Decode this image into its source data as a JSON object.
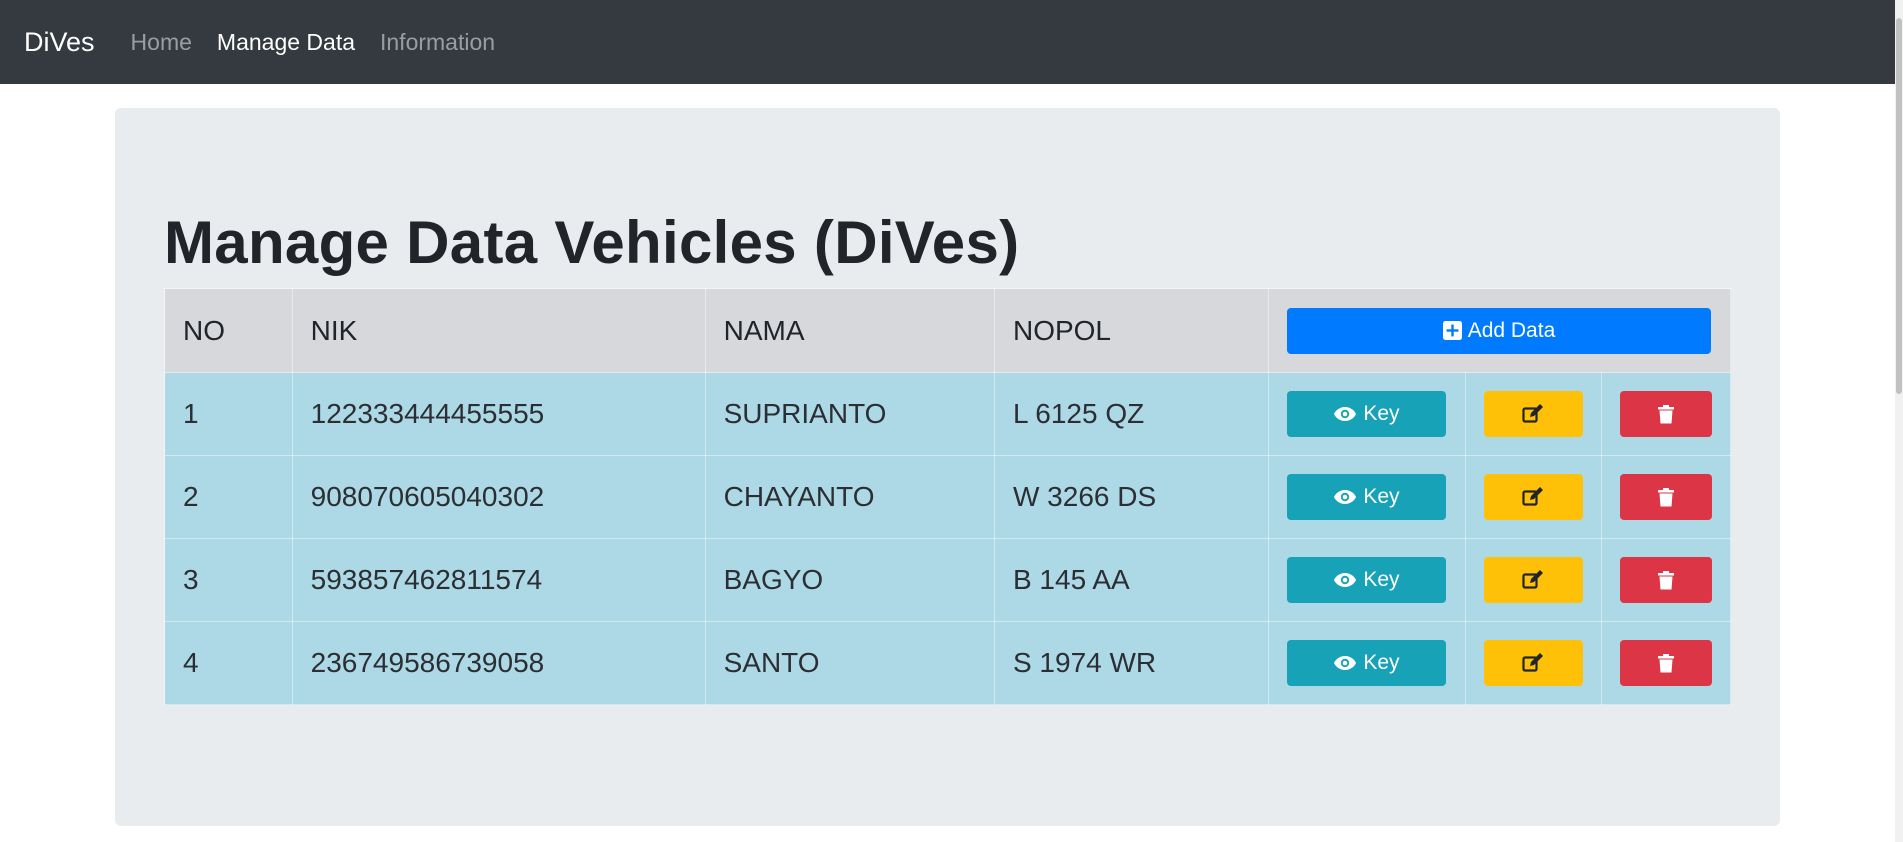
{
  "navbar": {
    "brand": "DiVes",
    "links": [
      {
        "label": "Home",
        "active": false
      },
      {
        "label": "Manage Data",
        "active": true
      },
      {
        "label": "Information",
        "active": false
      }
    ]
  },
  "page": {
    "title": "Manage Data Vehicles (DiVes)"
  },
  "table": {
    "headers": {
      "no": "NO",
      "nik": "NIK",
      "nama": "NAMA",
      "nopol": "NOPOL"
    },
    "add_button_label": "Add Data",
    "key_button_label": "Key",
    "rows": [
      {
        "no": "1",
        "nik": "122333444455555",
        "nama": "SUPRIANTO",
        "nopol": "L 6125 QZ"
      },
      {
        "no": "2",
        "nik": "908070605040302",
        "nama": "CHAYANTO",
        "nopol": "W 3266 DS"
      },
      {
        "no": "3",
        "nik": "593857462811574",
        "nama": "BAGYO",
        "nopol": "B 145 AA"
      },
      {
        "no": "4",
        "nik": "236749586739058",
        "nama": "SANTO",
        "nopol": "S 1974 WR"
      }
    ]
  },
  "colors": {
    "navbar": "#343a40",
    "primary": "#007bff",
    "info": "#17a2b8",
    "warning": "#ffc107",
    "danger": "#dc3545",
    "row_bg": "#add8e6"
  },
  "icons": {
    "add": "plus-square-icon",
    "key": "eye-icon",
    "edit": "edit-icon",
    "delete": "trash-icon"
  }
}
